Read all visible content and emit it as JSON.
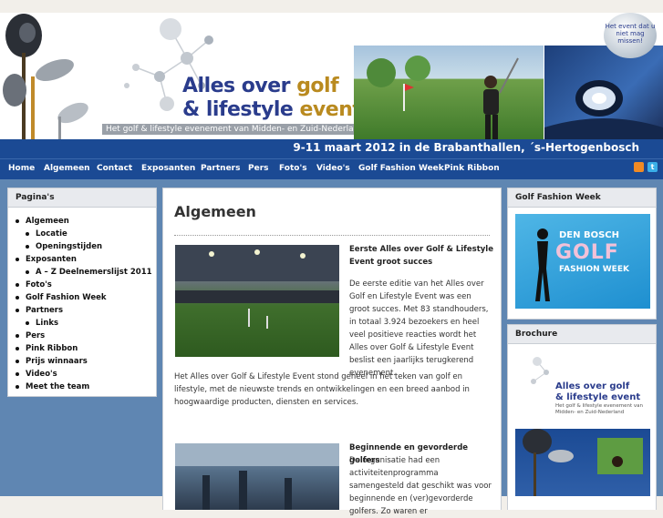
{
  "header": {
    "logo_line1_a": "Alles over",
    "logo_line1_b": "golf",
    "logo_line2_a": "& lifestyle",
    "logo_line2_b": "event",
    "tagline": "Het golf & lifestyle evenement van Midden- en Zuid-Nederland",
    "badge_text": "Het event dat u niet mag missen!",
    "date_text": "9-11 maart 2012 in de Brabanthallen, ´s-Hertogenbosch"
  },
  "nav": {
    "items": [
      {
        "label": "Home"
      },
      {
        "label": "Algemeen"
      },
      {
        "label": "Contact"
      },
      {
        "label": "Exposanten"
      },
      {
        "label": "Partners"
      },
      {
        "label": "Pers"
      },
      {
        "label": "Foto's"
      },
      {
        "label": "Video's"
      },
      {
        "label": "Golf Fashion Week"
      },
      {
        "label": "Pink Ribbon"
      }
    ],
    "icons": [
      "rss-icon",
      "twitter-icon"
    ]
  },
  "sidebar": {
    "title": "Pagina's",
    "items": [
      {
        "label": "Algemeen",
        "level": 1
      },
      {
        "label": "Locatie",
        "level": 2
      },
      {
        "label": "Openingstijden",
        "level": 2
      },
      {
        "label": "Exposanten",
        "level": 1
      },
      {
        "label": "A – Z Deelnemerslijst 2011",
        "level": 2
      },
      {
        "label": "Foto's",
        "level": 1
      },
      {
        "label": "Golf Fashion Week",
        "level": 1
      },
      {
        "label": "Partners",
        "level": 1
      },
      {
        "label": "Links",
        "level": 2
      },
      {
        "label": "Pers",
        "level": 1
      },
      {
        "label": "Pink Ribbon",
        "level": 1
      },
      {
        "label": "Prijs winnaars",
        "level": 1
      },
      {
        "label": "Video's",
        "level": 1
      },
      {
        "label": "Meet the team",
        "level": 1
      }
    ]
  },
  "main": {
    "title": "Algemeen",
    "article1": {
      "title": "Eerste Alles over Golf & Lifestyle Event groot succes",
      "body": "De eerste editie van het Alles over Golf en Lifestyle Event was een groot succes. Met 83 standhouders, in totaal 3.924 bezoekers en heel veel positieve reacties wordt het Alles over Golf & Lifestyle Event beslist een jaarlijks terugkerend evenement.",
      "more": "Het Alles over Golf & Lifestyle Event stond geheel in het teken van golf en lifestyle, met de nieuwste trends en ontwikkelingen en een breed aanbod in hoogwaardige producten, diensten en services."
    },
    "article2": {
      "title": "Beginnende en gevorderde golfers",
      "body": "De organisatie had een activiteitenprogramma samengesteld dat geschikt was voor beginnende en (ver)gevorderde golfers. Zo waren er"
    }
  },
  "right": {
    "gfw_title": "Golf Fashion Week",
    "gfw_banner": {
      "line1": "DEN BOSCH",
      "line2": "GOLF",
      "line3": "FASHION WEEK"
    },
    "brochure_title": "Brochure",
    "brochure_cover": {
      "line1": "Alles over golf",
      "line2": "& lifestyle event",
      "sub": "Het golf & lifestyle evenement van Midden- en Zuid-Nederland"
    }
  },
  "colors": {
    "nav_bg": "#1b4a94",
    "page_bg": "#5f86b2",
    "accent_gold": "#b98a1f",
    "logo_blue": "#2a3c8c"
  }
}
